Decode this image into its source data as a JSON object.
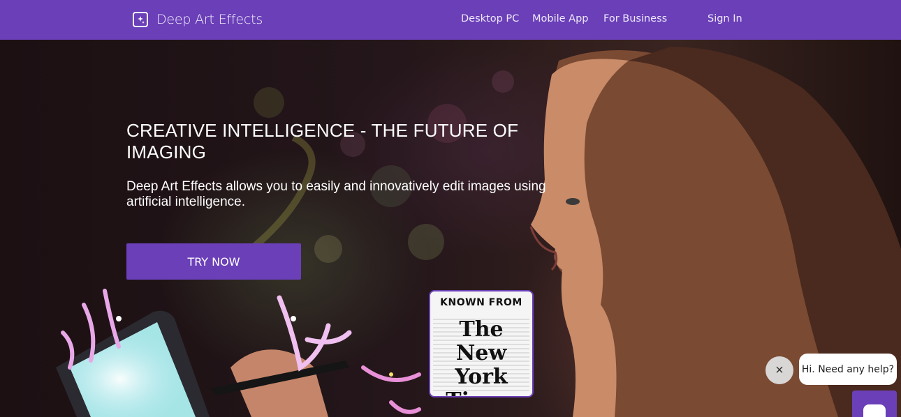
{
  "nav": {
    "brand": "Deep Art Effects",
    "links": [
      "Desktop PC",
      "Mobile App",
      "For Business",
      "Sign In"
    ]
  },
  "hero": {
    "title": "CREATIVE INTELLIGENCE - THE FUTURE OF IMAGING",
    "subtitle": "Deep Art Effects allows you to easily and innovatively edit images using artificial intelligence.",
    "cta": "TRY NOW"
  },
  "badge": {
    "known": "KNOWN FROM",
    "logo_lines": [
      "The",
      "New York",
      "Times"
    ]
  },
  "chat": {
    "close": "×",
    "message": "Hi. Need any help?"
  },
  "colors": {
    "brand": "#6a3fb8",
    "nav_text": "#efe9fb"
  }
}
